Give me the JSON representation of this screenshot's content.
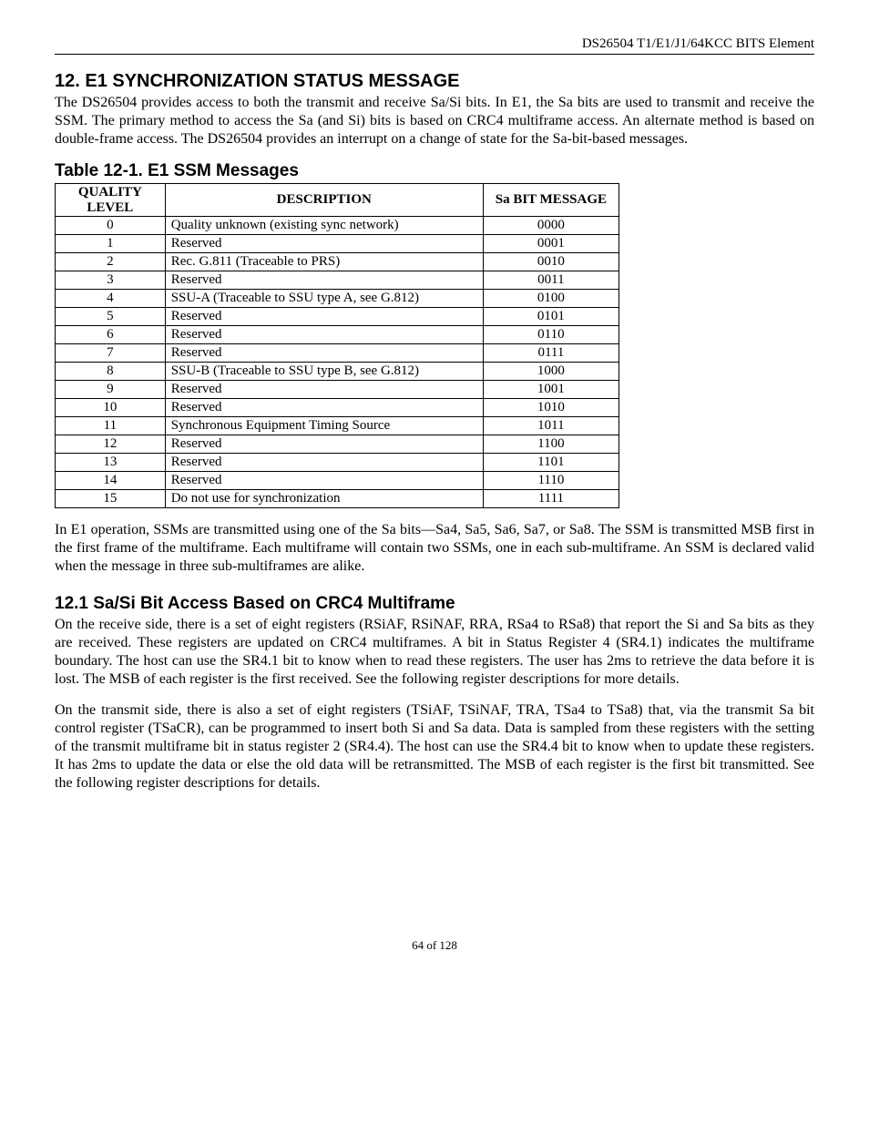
{
  "header": {
    "doc_title": "DS26504 T1/E1/J1/64KCC BITS Element"
  },
  "section12": {
    "heading": "12.  E1 SYNCHRONIZATION STATUS MESSAGE",
    "intro": "The DS26504 provides access to both the transmit and receive Sa/Si bits. In E1, the Sa bits are used to transmit and receive the SSM. The primary method to access the Sa (and Si) bits is based on CRC4 multiframe access. An alternate method is based on double-frame access. The DS26504 provides an interrupt on a change of state for the Sa-bit-based messages.",
    "table_title": "Table 12-1. E1 SSM Messages",
    "table": {
      "headers": {
        "quality": "QUALITY LEVEL",
        "description": "DESCRIPTION",
        "sabit": "Sa BIT MESSAGE"
      }
    },
    "post_table": "In E1 operation, SSMs are transmitted using one of the Sa bits—Sa4, Sa5, Sa6, Sa7, or Sa8.  The SSM is transmitted MSB first in the first frame of the multiframe. Each multiframe will contain two SSMs, one in each sub-multiframe. An SSM is declared valid when the message in three sub-multiframes are alike."
  },
  "section12_1": {
    "heading": "12.1  Sa/Si Bit Access Based on CRC4 Multiframe",
    "para1": "On the receive side, there is a set of eight registers (RSiAF, RSiNAF, RRA, RSa4 to RSa8) that report the Si and Sa bits as they are received. These registers are updated on CRC4 multiframes. A bit in Status Register 4 (SR4.1) indicates the multiframe boundary. The host can use the SR4.1 bit to know when to read these registers. The user has 2ms to retrieve the data before it is lost. The MSB of each register is the first received. See the following register descriptions for more details.",
    "para2": "On the transmit side, there is also a set of eight registers (TSiAF, TSiNAF, TRA, TSa4 to TSa8) that, via the transmit Sa bit control register (TSaCR), can be programmed to insert both Si and Sa data. Data is sampled from these registers with the setting of the transmit multiframe bit in status register 2 (SR4.4). The host can use the SR4.4 bit to know when to update these registers. It has 2ms to update the data or else the old data will be retransmitted. The MSB of each register is the first bit transmitted. See the following register descriptions for details."
  },
  "footer": {
    "page": "64 of 128"
  },
  "chart_data": {
    "type": "table",
    "title": "Table 12-1. E1 SSM Messages",
    "columns": [
      "QUALITY LEVEL",
      "DESCRIPTION",
      "Sa BIT MESSAGE"
    ],
    "rows": [
      {
        "quality": "0",
        "description": "Quality unknown (existing sync network)",
        "sabit": "0000"
      },
      {
        "quality": "1",
        "description": "Reserved",
        "sabit": "0001"
      },
      {
        "quality": "2",
        "description": "Rec. G.811 (Traceable to PRS)",
        "sabit": "0010"
      },
      {
        "quality": "3",
        "description": "Reserved",
        "sabit": "0011"
      },
      {
        "quality": "4",
        "description": "SSU-A (Traceable to SSU type A, see G.812)",
        "sabit": "0100"
      },
      {
        "quality": "5",
        "description": "Reserved",
        "sabit": "0101"
      },
      {
        "quality": "6",
        "description": "Reserved",
        "sabit": "0110"
      },
      {
        "quality": "7",
        "description": "Reserved",
        "sabit": "0111"
      },
      {
        "quality": "8",
        "description": "SSU-B (Traceable to SSU type B, see G.812)",
        "sabit": "1000"
      },
      {
        "quality": "9",
        "description": "Reserved",
        "sabit": "1001"
      },
      {
        "quality": "10",
        "description": "Reserved",
        "sabit": "1010"
      },
      {
        "quality": "11",
        "description": "Synchronous Equipment Timing Source",
        "sabit": "1011"
      },
      {
        "quality": "12",
        "description": "Reserved",
        "sabit": "1100"
      },
      {
        "quality": "13",
        "description": "Reserved",
        "sabit": "1101"
      },
      {
        "quality": "14",
        "description": "Reserved",
        "sabit": "1110"
      },
      {
        "quality": "15",
        "description": "Do not use for synchronization",
        "sabit": "1111"
      }
    ]
  }
}
